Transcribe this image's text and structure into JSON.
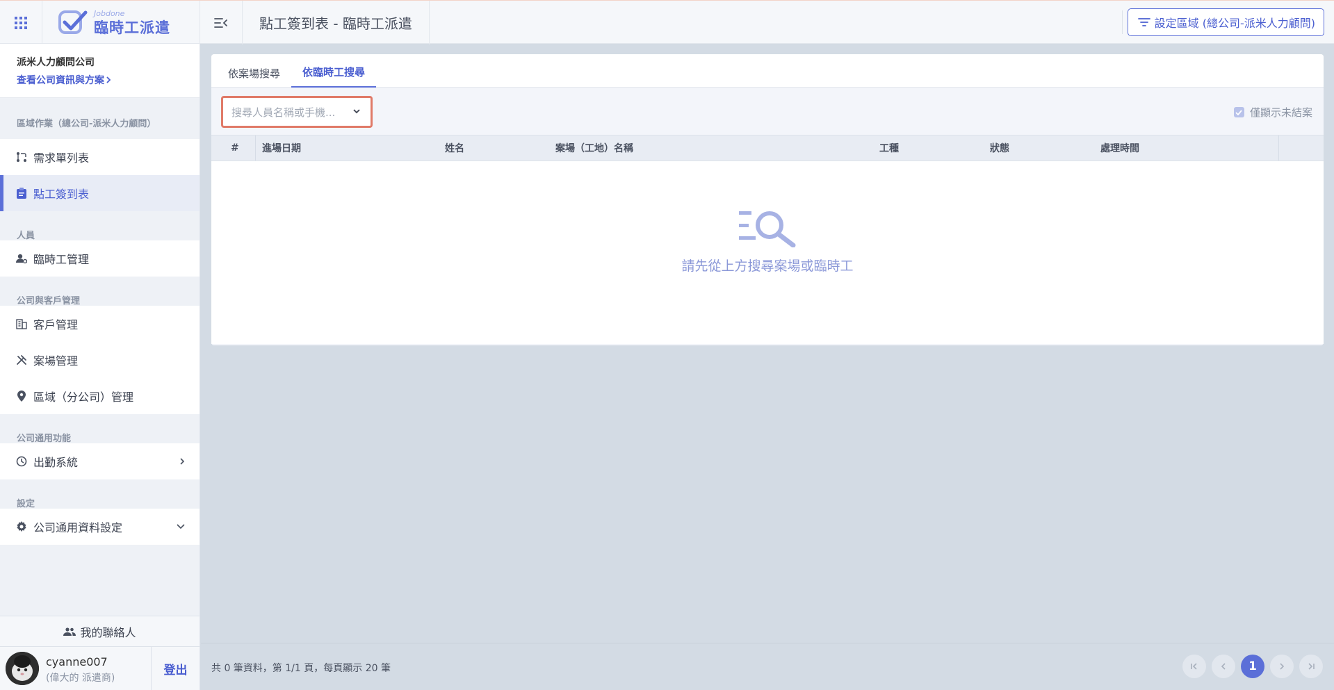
{
  "app": {
    "logo_sub": "Jobdone",
    "logo_main": "臨時工派遣",
    "page_title": "點工簽到表 - 臨時工派遣",
    "region_button": "設定區域 (總公司-派米人力顧問)"
  },
  "company": {
    "name": "派米人力顧問公司",
    "link": "查看公司資訊與方案"
  },
  "sidebar": {
    "sections": [
      {
        "title": "區域作業（總公司-派米人力顧問）",
        "items": [
          {
            "label": "需求單列表",
            "icon": "request-list-icon"
          },
          {
            "label": "點工簽到表",
            "icon": "clipboard-icon",
            "active": true
          }
        ]
      },
      {
        "title": "人員",
        "items": [
          {
            "label": "臨時工管理",
            "icon": "worker-settings-icon"
          }
        ]
      },
      {
        "title": "公司與客戶管理",
        "items": [
          {
            "label": "客戶管理",
            "icon": "building-icon"
          },
          {
            "label": "案場管理",
            "icon": "tools-icon"
          },
          {
            "label": "區域（分公司）管理",
            "icon": "location-pin-icon"
          }
        ]
      },
      {
        "title": "公司通用功能",
        "items": [
          {
            "label": "出勤系統",
            "icon": "clock-icon"
          }
        ]
      },
      {
        "title": "設定",
        "items": [
          {
            "label": "公司通用資料設定",
            "icon": "gear-icon"
          }
        ]
      }
    ],
    "contacts": "我的聯絡人",
    "user_name": "cyanne007",
    "user_role": "(偉大的 派遣商)",
    "logout": "登出"
  },
  "main": {
    "tabs": [
      "依案場搜尋",
      "依臨時工搜尋"
    ],
    "active_tab": 1,
    "search_placeholder": "搜尋人員名稱或手機...",
    "only_open_label": "僅顯示未結案",
    "columns": [
      "#",
      "進場日期",
      "姓名",
      "案場（工地）名稱",
      "工種",
      "狀態",
      "處理時間"
    ],
    "empty_text": "請先從上方搜尋案場或臨時工"
  },
  "footer": {
    "summary": "共 0 筆資料，第 1/1 頁，每頁顯示 20 筆",
    "current_page": "1"
  },
  "colors": {
    "accent": "#5b6fd8",
    "highlight_border": "#e07a68",
    "background": "#d3dbe4"
  }
}
